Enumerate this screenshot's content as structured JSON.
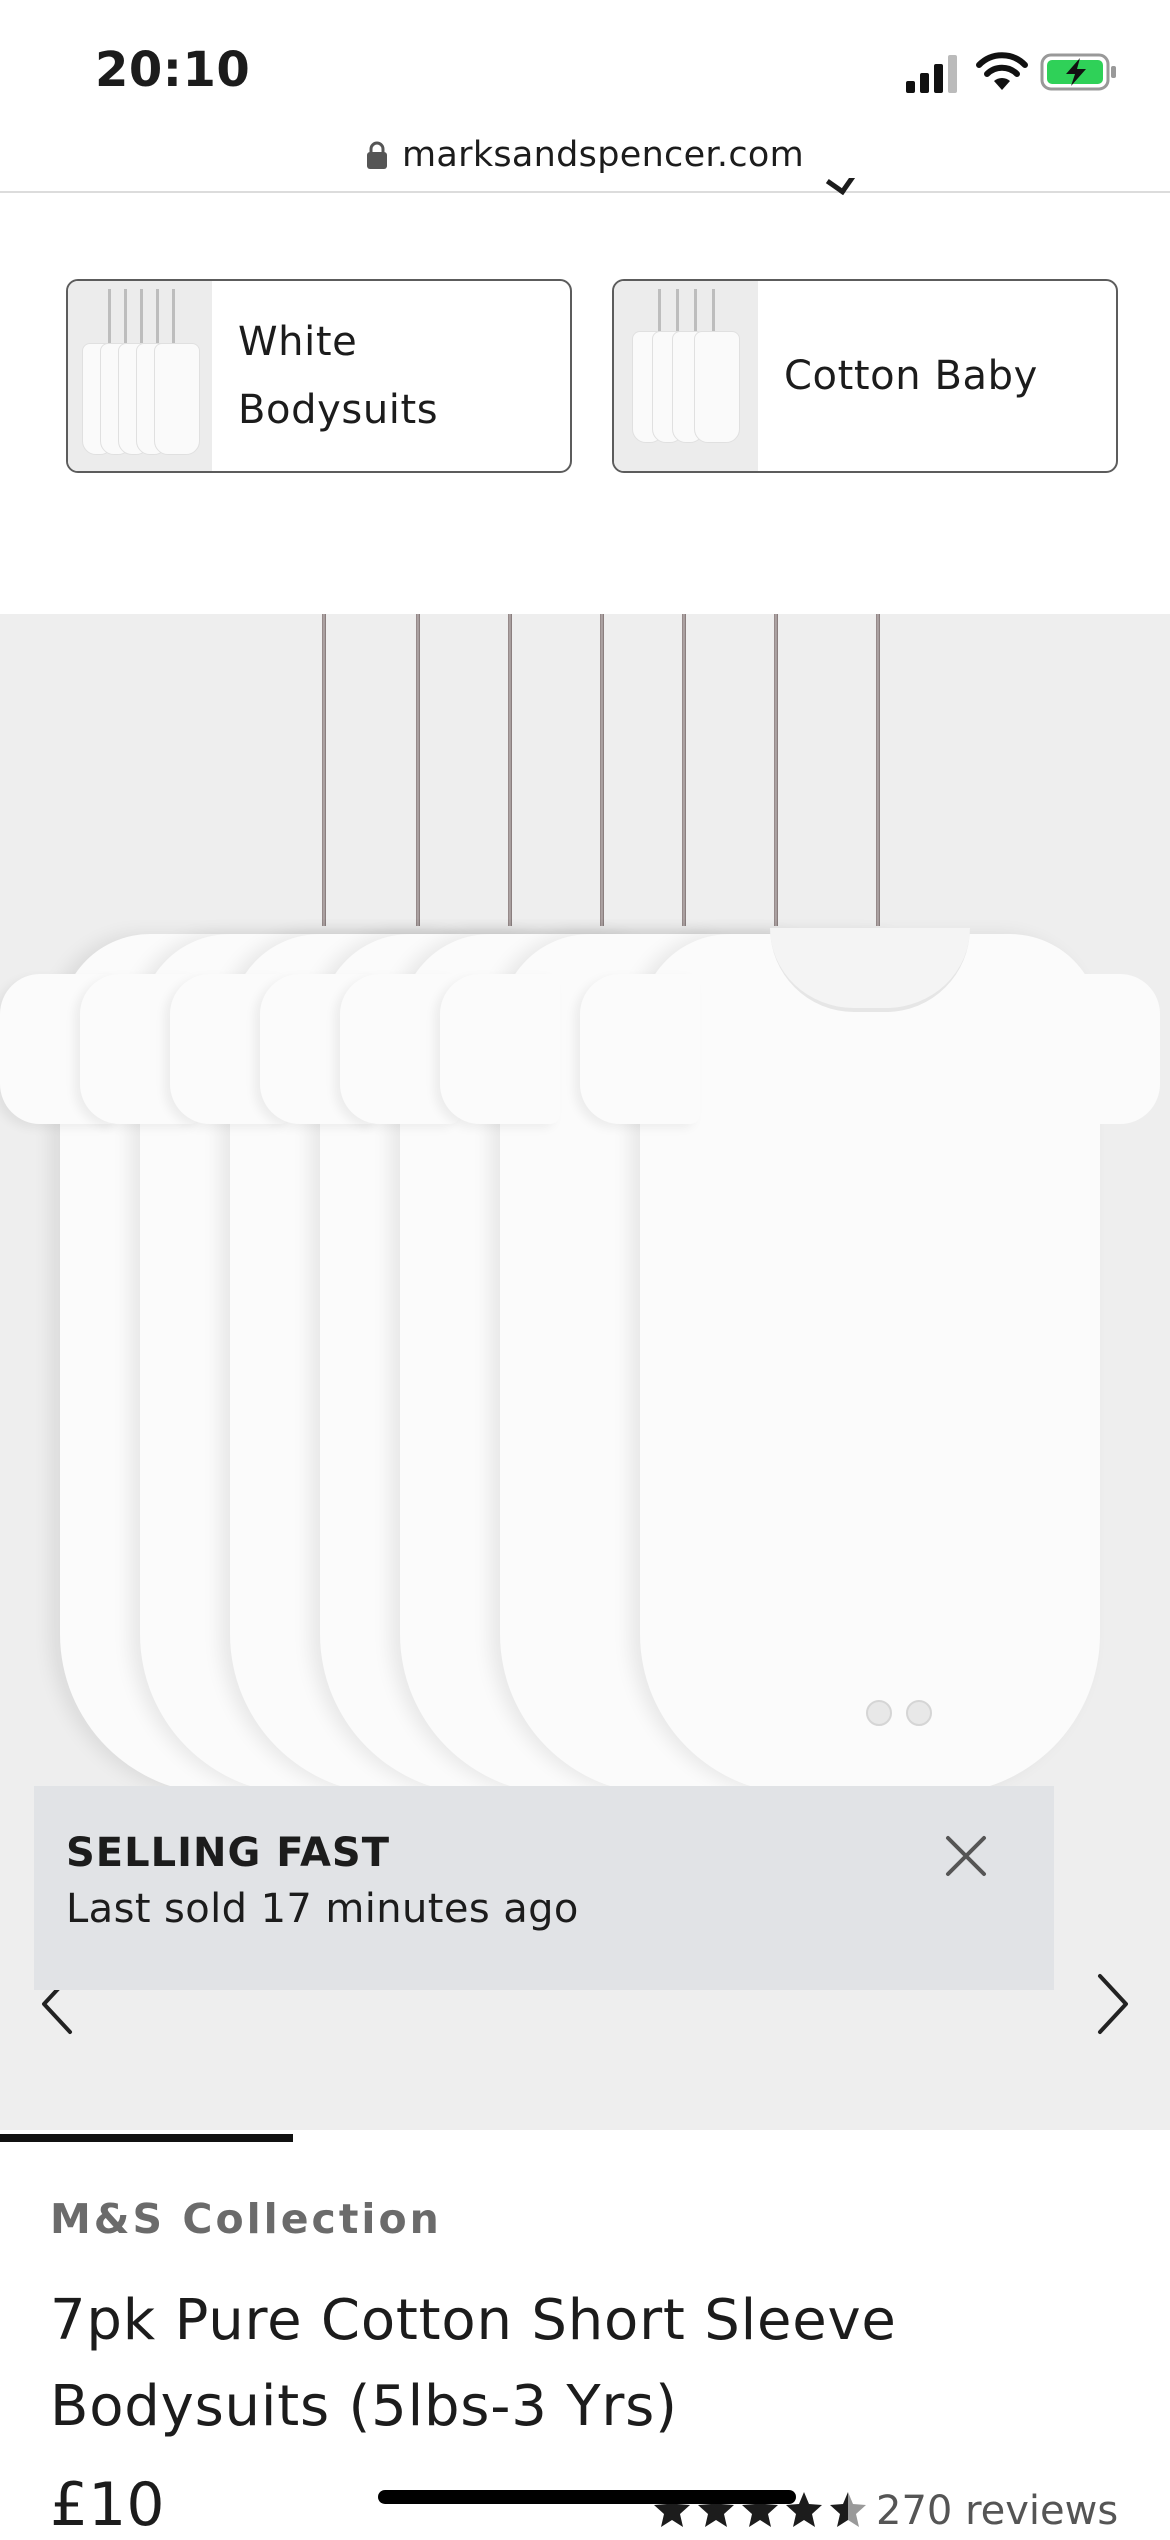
{
  "status_bar": {
    "time": "20:10"
  },
  "browser": {
    "url": "marksandspencer.com"
  },
  "related_searches": [
    {
      "label_line1": "White",
      "label_line2": "Bodysuits"
    },
    {
      "label_line1": "Cotton Baby",
      "label_line2": ""
    }
  ],
  "product_image": {
    "alt_icons": [
      "chevron-left-icon",
      "chevron-right-icon"
    ],
    "carousel_progress": 0.25
  },
  "selling_banner": {
    "title": "SELLING FAST",
    "subtitle": "Last sold 17 minutes ago"
  },
  "product": {
    "brand": "M&S Collection",
    "title": "7pk Pure Cotton Short Sleeve Bodysuits (5lbs-3 Yrs)",
    "price": "£10",
    "rating": 4.5,
    "reviews": "270 reviews"
  },
  "colors": {
    "banner_bg": "#e1e3e6",
    "image_bg": "#eeeeee",
    "text": "#1c1c1c",
    "brand_text": "#6b6b6b"
  }
}
